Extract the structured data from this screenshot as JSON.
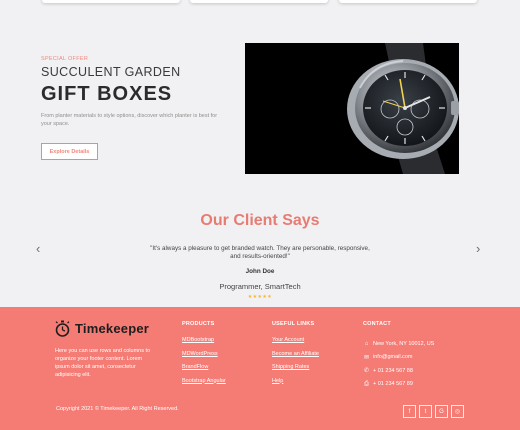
{
  "offer": {
    "kicker": "Special offer",
    "title_line1": "SUCCULENT GARDEN",
    "title_line2": "GIFT BOXES",
    "description": "From planter materials to style options, discover which planter is best for your space.",
    "button_label": "Explore Details"
  },
  "testimonials": {
    "heading": "Our Client Says",
    "prev_glyph": "‹",
    "next_glyph": "›",
    "quote": "\"It's always a pleasure to get branded watch. They are personable, responsive, and results-oriented!\"",
    "name": "John Doe",
    "role": "Programmer, SmartTech",
    "stars": "★★★★★",
    "rating": 5
  },
  "footer": {
    "brand": "Timekeeper",
    "about": "Here you can use rows and columns to organize your footer content. Lorem ipsum dolor sit amet, consectetur adipisicing elit.",
    "products": {
      "heading": "Products",
      "links": [
        "MDBootstrap",
        "MDWordPress",
        "BrandFlow",
        "Bootstrap Angular"
      ]
    },
    "useful": {
      "heading": "Useful links",
      "links": [
        "Your Account",
        "Become an Affiliate",
        "Shipping Rates",
        "Help"
      ]
    },
    "contact": {
      "heading": "Contact",
      "items": [
        {
          "icon": "home-icon",
          "text": "New York, NY 10012, US"
        },
        {
          "icon": "envelope-icon",
          "text": "info@gmail.com"
        },
        {
          "icon": "phone-icon",
          "text": "+ 01 234 567 88"
        },
        {
          "icon": "print-icon",
          "text": "+ 01 234 567 89"
        }
      ]
    },
    "copyright": "Copyright 2021 © Timekeeper. All Right Reserved.",
    "socials": [
      {
        "icon": "facebook-icon",
        "glyph": "f"
      },
      {
        "icon": "twitter-icon",
        "glyph": "t"
      },
      {
        "icon": "google-icon",
        "glyph": "G"
      },
      {
        "icon": "instagram-icon",
        "glyph": "◎"
      }
    ]
  },
  "colors": {
    "accent": "#f47c75",
    "heading_accent": "#e77c73",
    "star": "#f5b731"
  }
}
